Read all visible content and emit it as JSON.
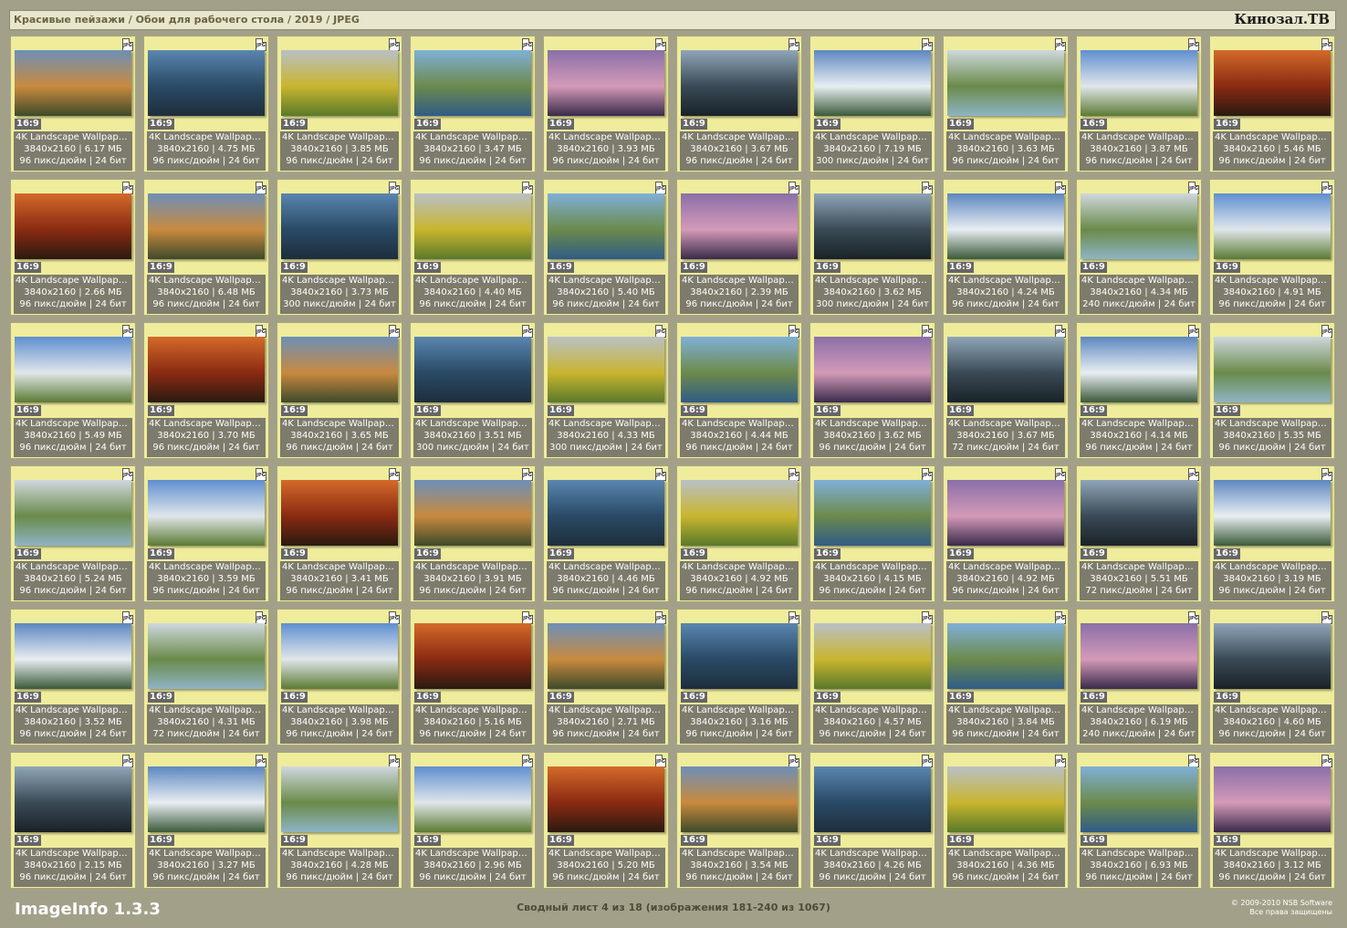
{
  "header": {
    "breadcrumb": "Красивые пейзажи / Обои для рабочего стола / 2019 / JPEG",
    "site": "Кинозал.ТВ"
  },
  "icons": {
    "file_type": "JPG"
  },
  "colors": {
    "background": "#a3a08a",
    "card": "#efec9c",
    "info_panel": "#7d7b6c",
    "header_bar": "#e8e6cc"
  },
  "thumbnails": [
    {
      "ratio": "16:9",
      "title": "4K Landscape Wallpape...",
      "size": "3840x2160 | 6.17 МБ",
      "meta": "96 пикс/дюйм | 24 бит"
    },
    {
      "ratio": "16:9",
      "title": "4K Landscape Wallpape...",
      "size": "3840x2160 | 4.75 МБ",
      "meta": "96 пикс/дюйм | 24 бит"
    },
    {
      "ratio": "16:9",
      "title": "4K Landscape Wallpape...",
      "size": "3840x2160 | 3.85 МБ",
      "meta": "96 пикс/дюйм | 24 бит"
    },
    {
      "ratio": "16:9",
      "title": "4K Landscape Wallpape...",
      "size": "3840x2160 | 3.47 МБ",
      "meta": "96 пикс/дюйм | 24 бит"
    },
    {
      "ratio": "16:9",
      "title": "4K Landscape Wallpape...",
      "size": "3840x2160 | 3.93 МБ",
      "meta": "96 пикс/дюйм | 24 бит"
    },
    {
      "ratio": "16:9",
      "title": "4K Landscape Wallpape...",
      "size": "3840x2160 | 3.67 МБ",
      "meta": "96 пикс/дюйм | 24 бит"
    },
    {
      "ratio": "16:9",
      "title": "4K Landscape Wallpape...",
      "size": "3840x2160 | 7.19 МБ",
      "meta": "300 пикс/дюйм | 24 бит"
    },
    {
      "ratio": "16:9",
      "title": "4K Landscape Wallpape...",
      "size": "3840x2160 | 3.63 МБ",
      "meta": "96 пикс/дюйм | 24 бит"
    },
    {
      "ratio": "16:9",
      "title": "4K Landscape Wallpape...",
      "size": "3840x2160 | 3.87 МБ",
      "meta": "96 пикс/дюйм | 24 бит"
    },
    {
      "ratio": "16:9",
      "title": "4K Landscape Wallpape...",
      "size": "3840x2160 | 5.46 МБ",
      "meta": "96 пикс/дюйм | 24 бит"
    },
    {
      "ratio": "16:9",
      "title": "4K Landscape Wallpape...",
      "size": "3840x2160 | 2.66 МБ",
      "meta": "96 пикс/дюйм | 24 бит"
    },
    {
      "ratio": "16:9",
      "title": "4K Landscape Wallpape...",
      "size": "3840x2160 | 6.48 МБ",
      "meta": "96 пикс/дюйм | 24 бит"
    },
    {
      "ratio": "16:9",
      "title": "4K Landscape Wallpape...",
      "size": "3840x2160 | 3.73 МБ",
      "meta": "300 пикс/дюйм | 24 бит"
    },
    {
      "ratio": "16:9",
      "title": "4K Landscape Wallpape...",
      "size": "3840x2160 | 4.40 МБ",
      "meta": "96 пикс/дюйм | 24 бит"
    },
    {
      "ratio": "16:9",
      "title": "4K Landscape Wallpape...",
      "size": "3840x2160 | 5.40 МБ",
      "meta": "96 пикс/дюйм | 24 бит"
    },
    {
      "ratio": "16:9",
      "title": "4K Landscape Wallpape...",
      "size": "3840x2160 | 2.39 МБ",
      "meta": "96 пикс/дюйм | 24 бит"
    },
    {
      "ratio": "16:9",
      "title": "4K Landscape Wallpape...",
      "size": "3840x2160 | 3.62 МБ",
      "meta": "300 пикс/дюйм | 24 бит"
    },
    {
      "ratio": "16:9",
      "title": "4K Landscape Wallpape...",
      "size": "3840x2160 | 4.24 МБ",
      "meta": "96 пикс/дюйм | 24 бит"
    },
    {
      "ratio": "16:9",
      "title": "4K Landscape Wallpape...",
      "size": "3840x2160 | 4.34 МБ",
      "meta": "240 пикс/дюйм | 24 бит"
    },
    {
      "ratio": "16:9",
      "title": "4K Landscape Wallpape...",
      "size": "3840x2160 | 4.91 МБ",
      "meta": "96 пикс/дюйм | 24 бит"
    },
    {
      "ratio": "16:9",
      "title": "4K Landscape Wallpape...",
      "size": "3840x2160 | 5.49 МБ",
      "meta": "96 пикс/дюйм | 24 бит"
    },
    {
      "ratio": "16:9",
      "title": "4K Landscape Wallpape...",
      "size": "3840x2160 | 3.70 МБ",
      "meta": "96 пикс/дюйм | 24 бит"
    },
    {
      "ratio": "16:9",
      "title": "4K Landscape Wallpape...",
      "size": "3840x2160 | 3.65 МБ",
      "meta": "96 пикс/дюйм | 24 бит"
    },
    {
      "ratio": "16:9",
      "title": "4K Landscape Wallpape...",
      "size": "3840x2160 | 3.51 МБ",
      "meta": "300 пикс/дюйм | 24 бит"
    },
    {
      "ratio": "16:9",
      "title": "4K Landscape Wallpape...",
      "size": "3840x2160 | 4.33 МБ",
      "meta": "300 пикс/дюйм | 24 бит"
    },
    {
      "ratio": "16:9",
      "title": "4K Landscape Wallpape...",
      "size": "3840x2160 | 4.44 МБ",
      "meta": "96 пикс/дюйм | 24 бит"
    },
    {
      "ratio": "16:9",
      "title": "4K Landscape Wallpape...",
      "size": "3840x2160 | 3.62 МБ",
      "meta": "96 пикс/дюйм | 24 бит"
    },
    {
      "ratio": "16:9",
      "title": "4K Landscape Wallpape...",
      "size": "3840x2160 | 3.67 МБ",
      "meta": "72 пикс/дюйм | 24 бит"
    },
    {
      "ratio": "16:9",
      "title": "4K Landscape Wallpape...",
      "size": "3840x2160 | 4.14 МБ",
      "meta": "96 пикс/дюйм | 24 бит"
    },
    {
      "ratio": "16:9",
      "title": "4K Landscape Wallpape...",
      "size": "3840x2160 | 5.35 МБ",
      "meta": "96 пикс/дюйм | 24 бит"
    },
    {
      "ratio": "16:9",
      "title": "4K Landscape Wallpape...",
      "size": "3840x2160 | 5.24 МБ",
      "meta": "96 пикс/дюйм | 24 бит"
    },
    {
      "ratio": "16:9",
      "title": "4K Landscape Wallpape...",
      "size": "3840x2160 | 3.59 МБ",
      "meta": "96 пикс/дюйм | 24 бит"
    },
    {
      "ratio": "16:9",
      "title": "4K Landscape Wallpape...",
      "size": "3840x2160 | 3.41 МБ",
      "meta": "96 пикс/дюйм | 24 бит"
    },
    {
      "ratio": "16:9",
      "title": "4K Landscape Wallpape...",
      "size": "3840x2160 | 3.91 МБ",
      "meta": "96 пикс/дюйм | 24 бит"
    },
    {
      "ratio": "16:9",
      "title": "4K Landscape Wallpape...",
      "size": "3840x2160 | 4.46 МБ",
      "meta": "96 пикс/дюйм | 24 бит"
    },
    {
      "ratio": "16:9",
      "title": "4K Landscape Wallpape...",
      "size": "3840x2160 | 4.92 МБ",
      "meta": "96 пикс/дюйм | 24 бит"
    },
    {
      "ratio": "16:9",
      "title": "4K Landscape Wallpape...",
      "size": "3840x2160 | 4.15 МБ",
      "meta": "96 пикс/дюйм | 24 бит"
    },
    {
      "ratio": "16:9",
      "title": "4K Landscape Wallpape...",
      "size": "3840x2160 | 4.92 МБ",
      "meta": "96 пикс/дюйм | 24 бит"
    },
    {
      "ratio": "16:9",
      "title": "4K Landscape Wallpape...",
      "size": "3840x2160 | 5.51 МБ",
      "meta": "72 пикс/дюйм | 24 бит"
    },
    {
      "ratio": "16:9",
      "title": "4K Landscape Wallpape...",
      "size": "3840x2160 | 3.19 МБ",
      "meta": "96 пикс/дюйм | 24 бит"
    },
    {
      "ratio": "16:9",
      "title": "4K Landscape Wallpape...",
      "size": "3840x2160 | 3.52 МБ",
      "meta": "96 пикс/дюйм | 24 бит"
    },
    {
      "ratio": "16:9",
      "title": "4K Landscape Wallpape...",
      "size": "3840x2160 | 4.31 МБ",
      "meta": "72 пикс/дюйм | 24 бит"
    },
    {
      "ratio": "16:9",
      "title": "4K Landscape Wallpape...",
      "size": "3840x2160 | 3.98 МБ",
      "meta": "96 пикс/дюйм | 24 бит"
    },
    {
      "ratio": "16:9",
      "title": "4K Landscape Wallpape...",
      "size": "3840x2160 | 5.16 МБ",
      "meta": "96 пикс/дюйм | 24 бит"
    },
    {
      "ratio": "16:9",
      "title": "4K Landscape Wallpape...",
      "size": "3840x2160 | 2.71 МБ",
      "meta": "96 пикс/дюйм | 24 бит"
    },
    {
      "ratio": "16:9",
      "title": "4K Landscape Wallpape...",
      "size": "3840x2160 | 3.16 МБ",
      "meta": "96 пикс/дюйм | 24 бит"
    },
    {
      "ratio": "16:9",
      "title": "4K Landscape Wallpape...",
      "size": "3840x2160 | 4.57 МБ",
      "meta": "96 пикс/дюйм | 24 бит"
    },
    {
      "ratio": "16:9",
      "title": "4K Landscape Wallpape...",
      "size": "3840x2160 | 3.84 МБ",
      "meta": "96 пикс/дюйм | 24 бит"
    },
    {
      "ratio": "16:9",
      "title": "4K Landscape Wallpape...",
      "size": "3840x2160 | 6.19 МБ",
      "meta": "240 пикс/дюйм | 24 бит"
    },
    {
      "ratio": "16:9",
      "title": "4K Landscape Wallpape...",
      "size": "3840x2160 | 4.60 МБ",
      "meta": "96 пикс/дюйм | 24 бит"
    },
    {
      "ratio": "16:9",
      "title": "4K Landscape Wallpape...",
      "size": "3840x2160 | 2.15 МБ",
      "meta": "96 пикс/дюйм | 24 бит"
    },
    {
      "ratio": "16:9",
      "title": "4K Landscape Wallpape...",
      "size": "3840x2160 | 3.27 МБ",
      "meta": "96 пикс/дюйм | 24 бит"
    },
    {
      "ratio": "16:9",
      "title": "4K Landscape Wallpape...",
      "size": "3840x2160 | 4.28 МБ",
      "meta": "96 пикс/дюйм | 24 бит"
    },
    {
      "ratio": "16:9",
      "title": "4K Landscape Wallpape...",
      "size": "3840x2160 | 2.96 МБ",
      "meta": "96 пикс/дюйм | 24 бит"
    },
    {
      "ratio": "16:9",
      "title": "4K Landscape Wallpape...",
      "size": "3840x2160 | 5.20 МБ",
      "meta": "96 пикс/дюйм | 24 бит"
    },
    {
      "ratio": "16:9",
      "title": "4K Landscape Wallpape...",
      "size": "3840x2160 | 3.54 МБ",
      "meta": "96 пикс/дюйм | 24 бит"
    },
    {
      "ratio": "16:9",
      "title": "4K Landscape Wallpape...",
      "size": "3840x2160 | 4.26 МБ",
      "meta": "96 пикс/дюйм | 24 бит"
    },
    {
      "ratio": "16:9",
      "title": "4K Landscape Wallpape...",
      "size": "3840x2160 | 4.36 МБ",
      "meta": "96 пикс/дюйм | 24 бит"
    },
    {
      "ratio": "16:9",
      "title": "4K Landscape Wallpape...",
      "size": "3840x2160 | 6.93 МБ",
      "meta": "96 пикс/дюйм | 24 бит"
    },
    {
      "ratio": "16:9",
      "title": "4K Landscape Wallpape...",
      "size": "3840x2160 | 3.12 МБ",
      "meta": "96 пикс/дюйм | 24 бит"
    }
  ],
  "footer": {
    "app": "ImageInfo 1.3.3",
    "sheet": "Сводный лист 4 из 18 (изображения 181-240 из 1067)",
    "copyright_line1": "© 2009-2010 NSB Software",
    "copyright_line2": "Все права защищены"
  }
}
